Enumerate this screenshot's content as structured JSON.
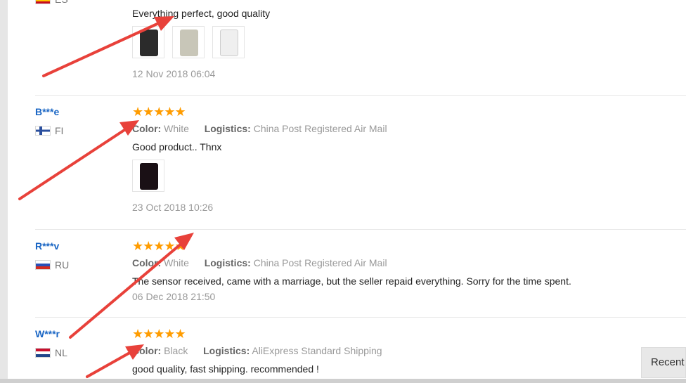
{
  "reviews": [
    {
      "country_code": "ES",
      "comment": "Everything perfect, good quality",
      "date": "12 Nov 2018 06:04",
      "stars": "★★★★★",
      "photos": [
        "#2b2b2b",
        "#c8c6b8",
        "#efefef"
      ]
    },
    {
      "user": "B***e",
      "country_code": "FI",
      "stars": "★★★★★",
      "color_label": "Color:",
      "color_value": "White",
      "logistics_label": "Logistics:",
      "logistics_value": "China Post Registered Air Mail",
      "comment": "Good product.. Thnx",
      "date": "23 Oct 2018 10:26",
      "photos": [
        "#1a1015"
      ]
    },
    {
      "user": "R***v",
      "country_code": "RU",
      "stars": "★★★★★",
      "color_label": "Color:",
      "color_value": "White",
      "logistics_label": "Logistics:",
      "logistics_value": "China Post Registered Air Mail",
      "comment": "The sensor received, came with a marriage, but the seller repaid everything. Sorry for the time spent.",
      "date": "06 Dec 2018 21:50"
    },
    {
      "user": "W***r",
      "country_code": "NL",
      "stars": "★★★★★",
      "color_label": "Color:",
      "color_value": "Black",
      "logistics_label": "Logistics:",
      "logistics_value": "AliExpress Standard Shipping",
      "comment": "good quality, fast shipping. recommended !"
    }
  ],
  "recent_tab": "Recent",
  "colors": {
    "accent_star": "#ff9c00",
    "username": "#1a66c4",
    "annotation_arrow": "#e8413a"
  }
}
